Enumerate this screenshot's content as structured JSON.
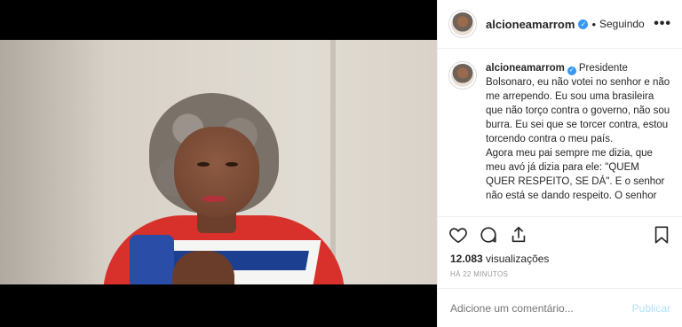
{
  "post": {
    "username": "alcioneamarrom",
    "follow_status": "Seguindo",
    "separator": "•",
    "more_label": "•••"
  },
  "caption": {
    "username": "alcioneamarrom",
    "text": "Presidente Bolsonaro, eu não votei no senhor e não me arrependo. Eu sou uma brasileira que não torço contra o governo, não sou burra. Eu sei que se torcer contra, estou torcendo contra o meu país.",
    "text2": "Agora meu pai sempre me dizia, que meu avó já dizia para ele: \"QUEM QUER RESPEITO, SE DÁ\". E o senhor não está se dando respeito. O senhor"
  },
  "stats": {
    "views_count": "12.083",
    "views_label": "visualizações",
    "timestamp": "HÁ 22 MINUTOS"
  },
  "comment": {
    "placeholder": "Adicione um comentário...",
    "publish_label": "Publicar"
  },
  "colors": {
    "verified": "#3897f0",
    "publish_disabled": "#b2dffc"
  },
  "icons": [
    "heart-icon",
    "comment-icon",
    "share-icon",
    "bookmark-icon",
    "verified-icon",
    "more-icon"
  ]
}
